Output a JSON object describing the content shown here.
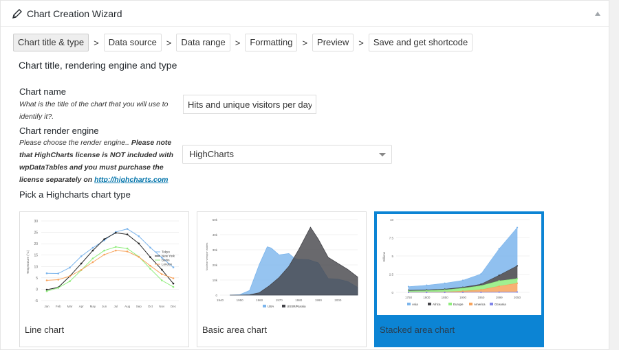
{
  "panel": {
    "title": "Chart Creation Wizard"
  },
  "steps": [
    {
      "label": "Chart title & type"
    },
    {
      "label": "Data source"
    },
    {
      "label": "Data range"
    },
    {
      "label": "Formatting"
    },
    {
      "label": "Preview"
    },
    {
      "label": "Save and get shortcode"
    }
  ],
  "step_separator": ">",
  "section_title": "Chart title, rendering engine and type",
  "chart_name": {
    "label": "Chart name",
    "description": "What is the title of the chart that you will use to identify it?.",
    "value": "Hits and unique visitors per day"
  },
  "render_engine": {
    "label": "Chart render engine",
    "desc_1": "Please choose the render engine.. ",
    "desc_bold": "Please note that HighCharts license is NOT included with wpDataTables and you must purchase the license separately on ",
    "desc_link": "http://highcharts.com",
    "selected": "HighCharts"
  },
  "pick_title": "Pick a Highcharts chart type",
  "cards": [
    {
      "label": "Line chart"
    },
    {
      "label": "Basic area chart"
    },
    {
      "label": "Stacked area chart"
    }
  ],
  "colors": {
    "accent": "#0c84d4",
    "link": "#0073aa"
  },
  "chart_data": [
    {
      "type": "line",
      "categories": [
        "Jan",
        "Feb",
        "Mar",
        "Apr",
        "May",
        "Jun",
        "Jul",
        "Aug",
        "Sep",
        "Oct",
        "Nov",
        "Dec"
      ],
      "ylabel": "Temperature (°C)",
      "yticks": [
        -5,
        0,
        5,
        10,
        15,
        20,
        25,
        30
      ],
      "ylim": [
        -5,
        30
      ],
      "series": [
        {
          "name": "Tokyo",
          "color": "#7cb5ec",
          "values": [
            7.0,
            6.9,
            9.5,
            14.5,
            18.2,
            21.5,
            25.2,
            26.5,
            23.3,
            18.3,
            13.9,
            9.6
          ]
        },
        {
          "name": "New York",
          "color": "#222222",
          "values": [
            -0.2,
            0.8,
            5.7,
            11.3,
            17.0,
            22.0,
            24.8,
            24.1,
            20.1,
            14.1,
            8.6,
            2.5
          ]
        },
        {
          "name": "Berlin",
          "color": "#90ed7d",
          "values": [
            -0.9,
            0.6,
            3.5,
            8.4,
            13.5,
            17.0,
            18.6,
            17.9,
            14.3,
            9.0,
            3.9,
            1.0
          ]
        },
        {
          "name": "London",
          "color": "#f7a35c",
          "values": [
            3.9,
            4.2,
            5.7,
            8.5,
            11.9,
            15.2,
            17.0,
            16.6,
            14.2,
            10.3,
            6.6,
            4.8
          ]
        }
      ]
    },
    {
      "type": "area",
      "xticks": [
        1940,
        1950,
        1960,
        1970,
        1980,
        1990,
        2000
      ],
      "ylabel": "Nuclear weapon states",
      "yticks": [
        "0",
        "10k",
        "20k",
        "30k",
        "40k",
        "50k"
      ],
      "ylim": [
        0,
        50000
      ],
      "series": [
        {
          "name": "USA",
          "color": "#7cb5ec",
          "values": [
            [
              1945,
              6
            ],
            [
              1950,
              299
            ],
            [
              1955,
              3057
            ],
            [
              1960,
              20434
            ],
            [
              1964,
              31982
            ],
            [
              1966,
              31175
            ],
            [
              1970,
              26662
            ],
            [
              1975,
              27519
            ],
            [
              1978,
              24218
            ],
            [
              1980,
              23764
            ],
            [
              1985,
              23450
            ],
            [
              1990,
              21392
            ],
            [
              1995,
              10979
            ],
            [
              2000,
              10577
            ],
            [
              2005,
              9000
            ],
            [
              2010,
              5113
            ]
          ]
        },
        {
          "name": "USSR/Russia",
          "color": "#434348",
          "values": [
            [
              1945,
              0
            ],
            [
              1950,
              5
            ],
            [
              1955,
              200
            ],
            [
              1960,
              1605
            ],
            [
              1965,
              6129
            ],
            [
              1970,
              11643
            ],
            [
              1975,
              19055
            ],
            [
              1980,
              30062
            ],
            [
              1986,
              45000
            ],
            [
              1990,
              37000
            ],
            [
              1995,
              25000
            ],
            [
              2000,
              21000
            ],
            [
              2005,
              17000
            ],
            [
              2010,
              12000
            ]
          ]
        }
      ]
    },
    {
      "type": "area",
      "stacked": true,
      "categories": [
        "1750",
        "1800",
        "1850",
        "1900",
        "1950",
        "1999",
        "2050"
      ],
      "ylabel": "Billions",
      "yticks": [
        0,
        2.5,
        5,
        7.5,
        10
      ],
      "ylim": [
        0,
        10
      ],
      "series": [
        {
          "name": "Asia",
          "color": "#7cb5ec",
          "values": [
            502,
            635,
            809,
            947,
            1402,
            3634,
            5268
          ]
        },
        {
          "name": "Africa",
          "color": "#434348",
          "values": [
            106,
            107,
            111,
            133,
            221,
            767,
            1766
          ]
        },
        {
          "name": "Europe",
          "color": "#90ed7d",
          "values": [
            163,
            203,
            276,
            408,
            547,
            729,
            628
          ]
        },
        {
          "name": "America",
          "color": "#f7a35c",
          "values": [
            18,
            31,
            54,
            156,
            339,
            818,
            1201
          ]
        },
        {
          "name": "Oceania",
          "color": "#8085e9",
          "values": [
            2,
            2,
            2,
            6,
            13,
            30,
            46
          ]
        }
      ]
    }
  ]
}
